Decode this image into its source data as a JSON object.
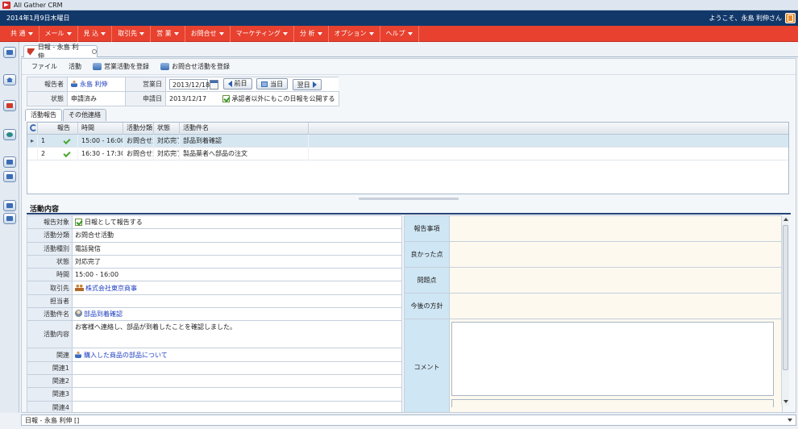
{
  "app": {
    "title": "All Gather CRM"
  },
  "topbar": {
    "date": "2014年1月9日木曜日",
    "welcome": "ようこそ、永島 利伸さん"
  },
  "menu": [
    "共 通",
    "メール",
    "見 込",
    "取引先",
    "営 業",
    "お問合せ",
    "マーケティング",
    "分 析",
    "オプション",
    "ヘルプ"
  ],
  "doc_tab": {
    "label": "日報 - 永島 利伸"
  },
  "toolbar": {
    "file": "ファイル",
    "activity": "活動",
    "register_sales": "営業活動を登録",
    "register_inquiry": "お問合せ活動を登録"
  },
  "header": {
    "reporter_label": "報告者",
    "reporter": "永島 利伸",
    "business_date_label": "営業日",
    "business_date": "2013/12/18",
    "prev": "前日",
    "today": "当日",
    "next": "翌日",
    "status_label": "状態",
    "status": "申請済み",
    "apply_date_label": "申請日",
    "apply_date": "2013/12/17",
    "publish_label": "承認者以外にもこの日報を公開する"
  },
  "subtabs": [
    "活動報告",
    "その他連絡"
  ],
  "grid": {
    "columns": [
      "報告",
      "時間",
      "活動分類",
      "状態",
      "活動件名"
    ],
    "rows": [
      {
        "no": "1",
        "time": "15:00 - 16:00",
        "category": "お問合せ活",
        "status": "対応完了",
        "subject": "部品到着確認"
      },
      {
        "no": "2",
        "time": "16:30 - 17:30",
        "category": "お問合せ活",
        "status": "対応完了",
        "subject": "製品薬者へ部品の注文"
      }
    ]
  },
  "detail": {
    "section_title": "活動内容",
    "labels": {
      "report_target": "報告対象",
      "category": "活動分類",
      "type": "活動種別",
      "status": "状態",
      "time": "時間",
      "account": "取引先",
      "owner": "担当者",
      "subject": "活動件名",
      "content": "活動内容",
      "related": "関連",
      "related1": "関連1",
      "related2": "関連2",
      "related3": "関連3",
      "related4": "関連4"
    },
    "values": {
      "report_target": "日報として報告する",
      "category": "お問合せ活動",
      "type": "電話発信",
      "status": "対応完了",
      "time": "15:00 - 16:00",
      "account": "株式会社東京商事",
      "subject": "部品到着確認",
      "content": "お客様へ連絡し、部品が到着したことを確認しました。",
      "related": "購入した商品の部品について"
    },
    "right_labels": {
      "report_item": "報告事項",
      "good_point": "良かった点",
      "problem": "問題点",
      "future": "今後の方針",
      "comment": "コメント"
    }
  },
  "statusbar": {
    "text": "日報 - 永島 利伸 []"
  }
}
